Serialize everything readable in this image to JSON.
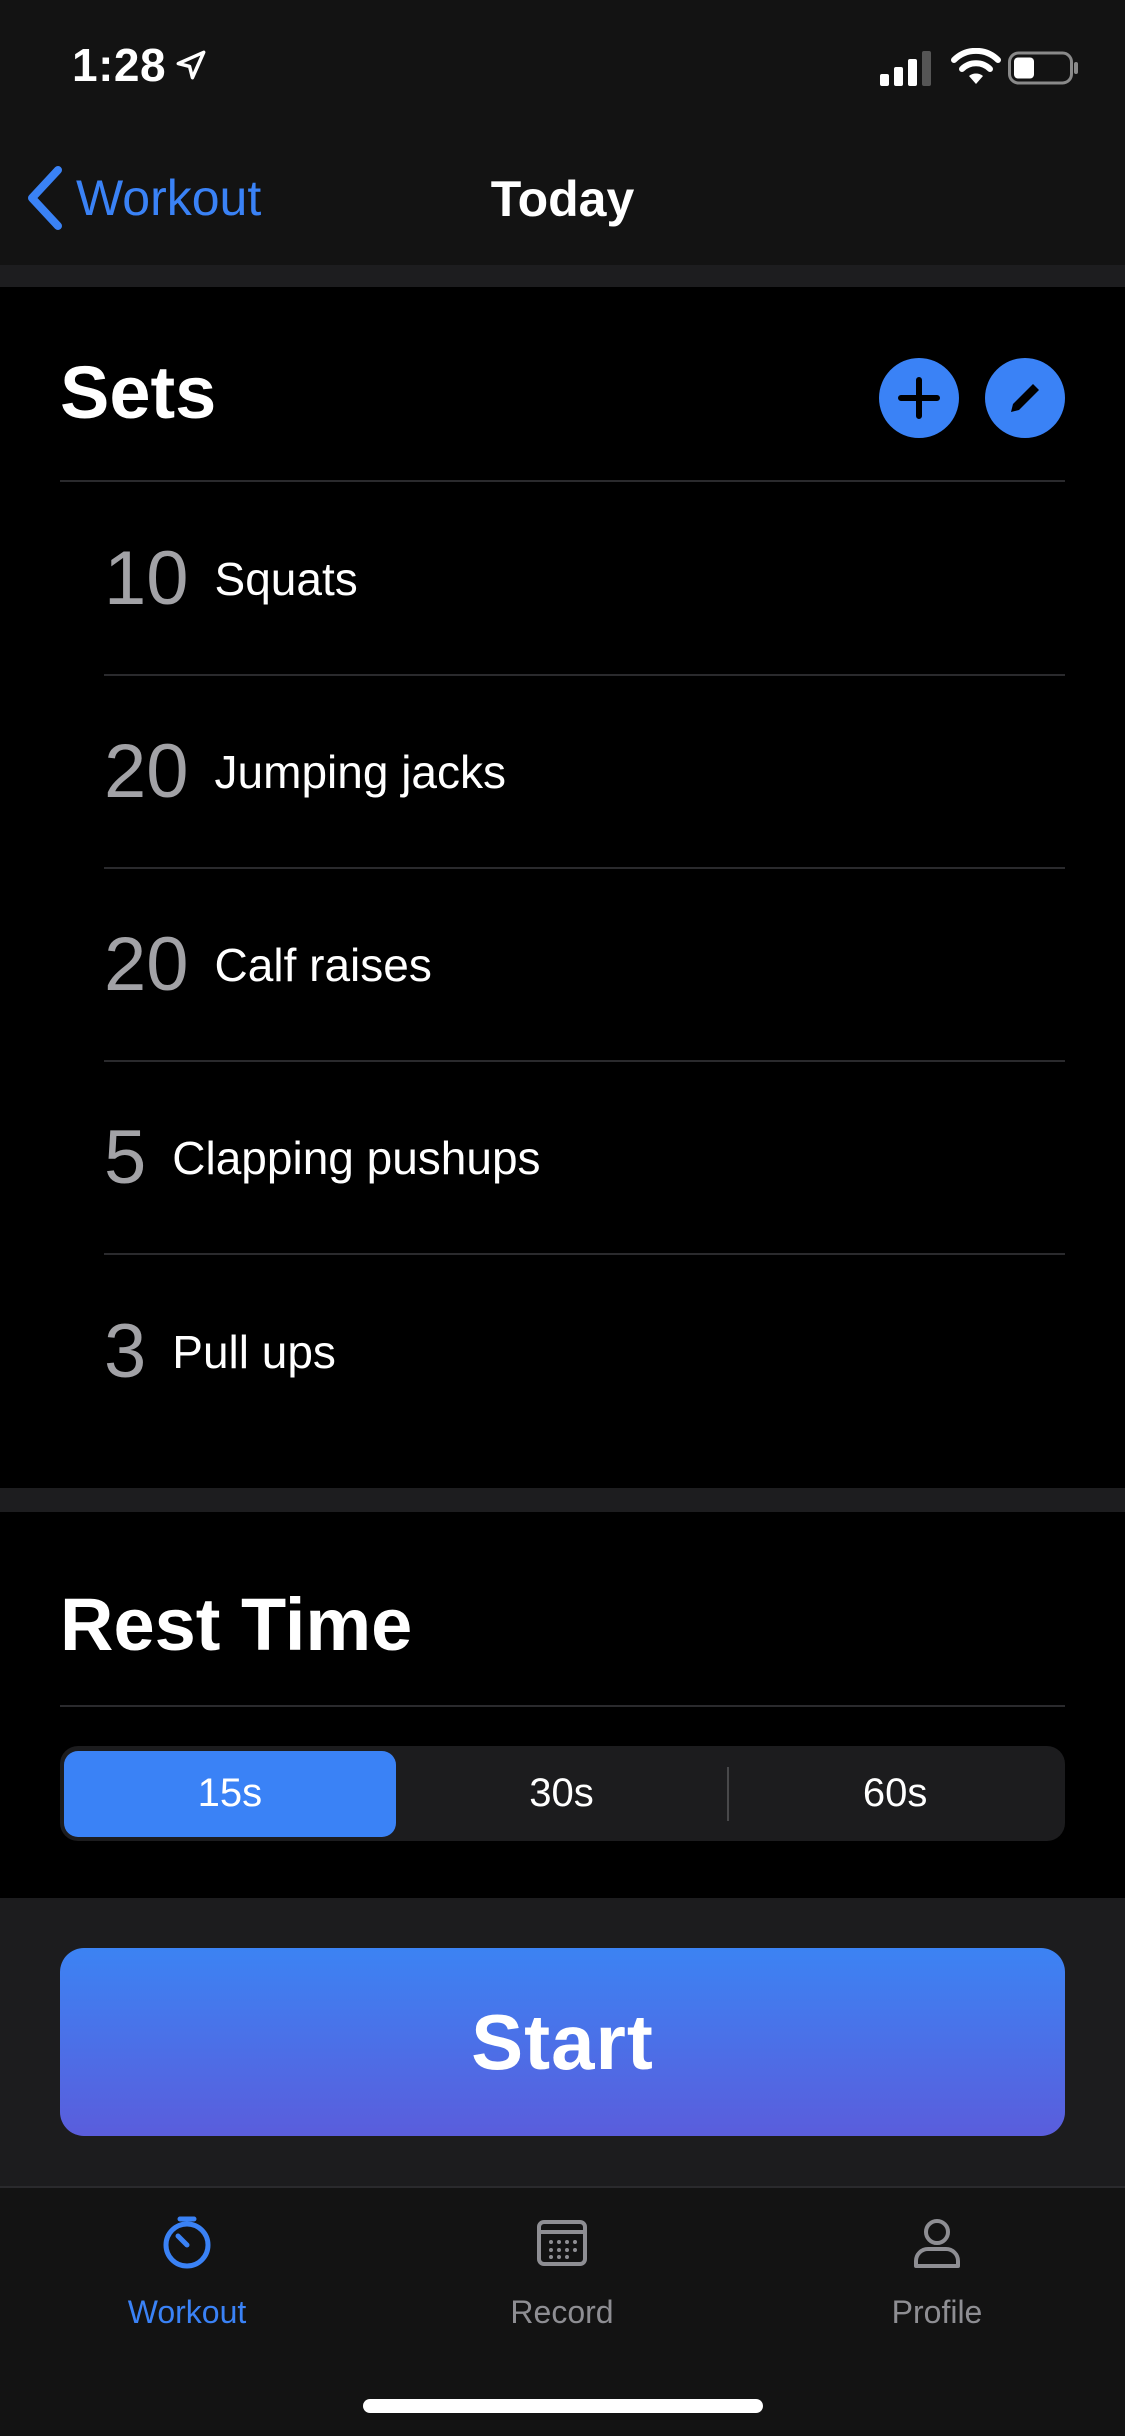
{
  "status_bar": {
    "time": "1:28"
  },
  "nav": {
    "back_label": "Workout",
    "title": "Today"
  },
  "sets": {
    "title": "Sets",
    "items": [
      {
        "reps": "10",
        "name": "Squats"
      },
      {
        "reps": "20",
        "name": "Jumping jacks"
      },
      {
        "reps": "20",
        "name": "Calf raises"
      },
      {
        "reps": "5",
        "name": "Clapping pushups"
      },
      {
        "reps": "3",
        "name": "Pull ups"
      }
    ]
  },
  "rest": {
    "title": "Rest Time",
    "options": [
      "15s",
      "30s",
      "60s"
    ],
    "selected": "15s"
  },
  "start_label": "Start",
  "tabs": {
    "workout": "Workout",
    "record": "Record",
    "profile": "Profile"
  },
  "colors": {
    "accent": "#3a82f6",
    "background": "#000000",
    "bar": "#131313"
  },
  "icons": [
    "location-arrow-icon",
    "cellular-signal-icon",
    "wifi-icon",
    "battery-icon",
    "chevron-left-icon",
    "plus-icon",
    "pencil-icon",
    "stopwatch-icon",
    "calendar-icon",
    "person-icon"
  ]
}
